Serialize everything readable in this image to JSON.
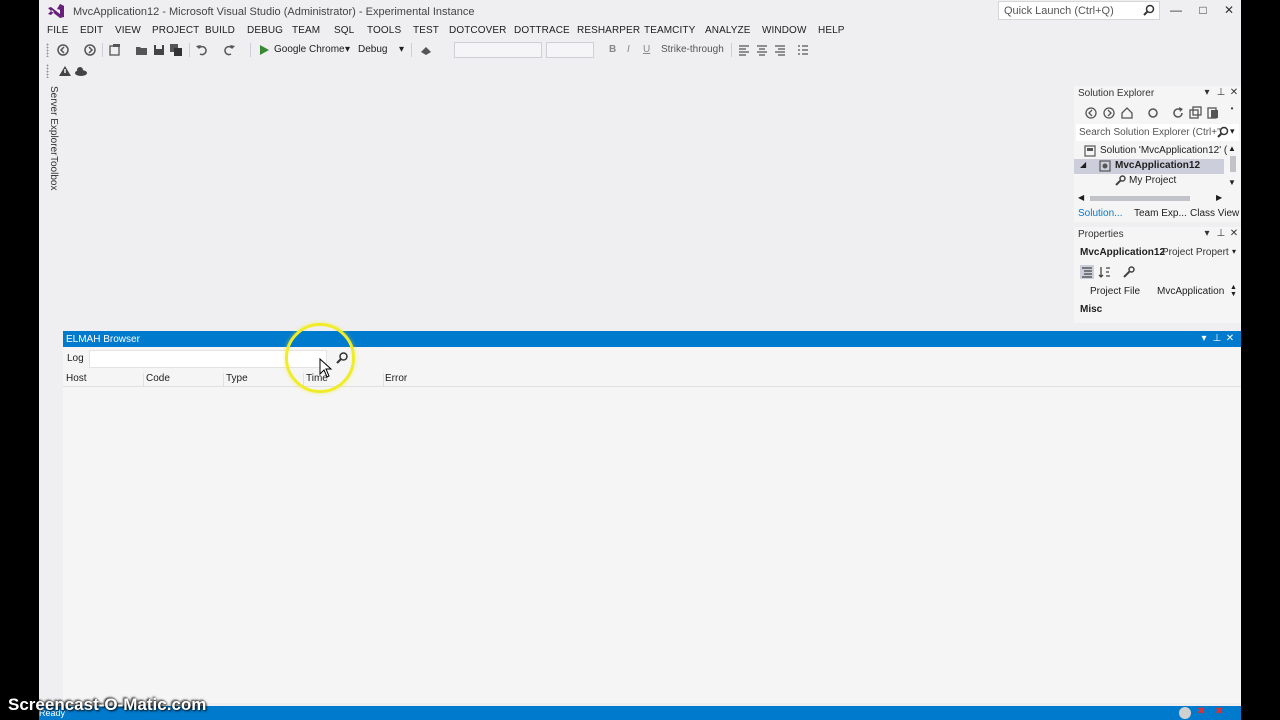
{
  "window": {
    "title": "MvcApplication12 - Microsoft Visual Studio (Administrator) - Experimental Instance",
    "quick_launch_placeholder": "Quick Launch (Ctrl+Q)"
  },
  "menu": [
    "FILE",
    "EDIT",
    "VIEW",
    "PROJECT",
    "BUILD",
    "DEBUG",
    "TEAM",
    "SQL",
    "TOOLS",
    "TEST",
    "DOTCOVER",
    "DOTTRACE",
    "RESHARPER",
    "TEAMCITY",
    "ANALYZE",
    "WINDOW",
    "HELP"
  ],
  "toolbar": {
    "run_target": "Google Chrome",
    "configuration": "Debug",
    "bold_label": "B",
    "italic_label": "I",
    "underline_label": "U",
    "strikethrough_label": "Strike-through"
  },
  "side_tabs": [
    "Server Explorer",
    "Toolbox"
  ],
  "solution_explorer": {
    "title": "Solution Explorer",
    "search_placeholder": "Search Solution Explorer (Ctrl+\"",
    "tree": [
      {
        "label": "Solution 'MvcApplication12' (",
        "level": 0
      },
      {
        "label": "MvcApplication12",
        "level": 1,
        "selected": true,
        "bold": true
      },
      {
        "label": "My Project",
        "level": 2
      }
    ],
    "tabs": [
      "Solution...",
      "Team Exp...",
      "Class View"
    ]
  },
  "properties": {
    "title": "Properties",
    "object": "MvcApplication12",
    "object_type": "Project Propert",
    "rows": [
      {
        "name": "Project File",
        "value": "MvcApplication"
      }
    ],
    "category": "Misc"
  },
  "elmah": {
    "title": "ELMAH Browser",
    "log_label": "Log",
    "log_value": "",
    "columns": [
      "Host",
      "Code",
      "Type",
      "Time",
      "Error"
    ]
  },
  "status": {
    "text": "Ready"
  },
  "watermark": "Screencast-O-Matic.com",
  "colors": {
    "accent": "#007acc",
    "chrome_bg": "#efeff2",
    "panel_bg": "#f5f5f5",
    "highlight_ring": "#f0ec2a"
  }
}
